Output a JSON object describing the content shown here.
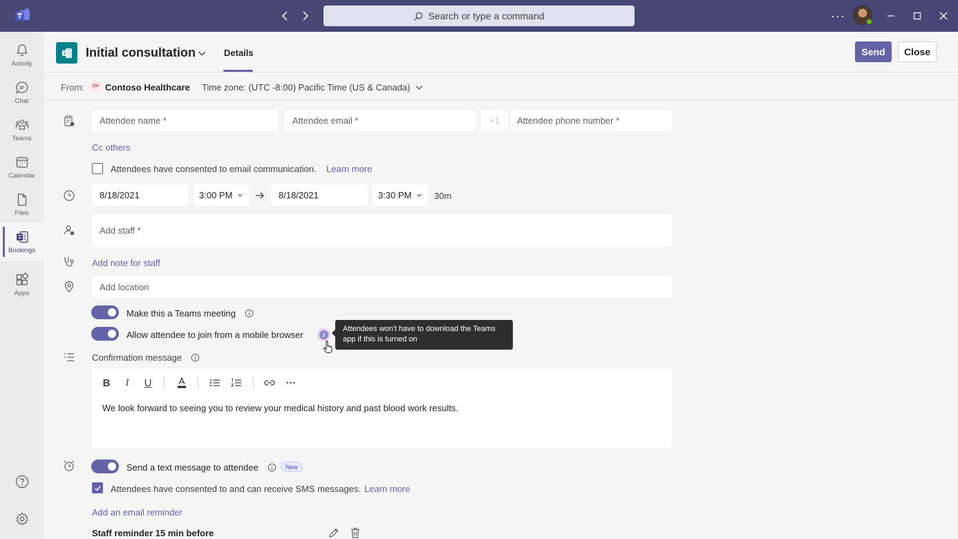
{
  "titlebar": {
    "search_placeholder": "Search or type a command",
    "more_label": "···"
  },
  "rail": {
    "items": [
      {
        "label": "Activity",
        "icon": "bell-icon"
      },
      {
        "label": "Chat",
        "icon": "chat-icon"
      },
      {
        "label": "Teams",
        "icon": "teams-icon"
      },
      {
        "label": "Calendar",
        "icon": "calendar-icon"
      },
      {
        "label": "Files",
        "icon": "file-icon"
      },
      {
        "label": "Bookings",
        "icon": "bookings-icon"
      },
      {
        "label": "Apps",
        "icon": "apps-icon"
      }
    ],
    "active": "Bookings"
  },
  "header": {
    "title": "Initial consultation",
    "tab_details": "Details",
    "send_label": "Send",
    "close_label": "Close"
  },
  "from_row": {
    "from_label": "From:",
    "business_initials": "CH",
    "business_name": "Contoso Healthcare",
    "timezone": "Time zone: (UTC -8:00) Pacific Time (US & Canada)"
  },
  "form": {
    "attendee_name_placeholder": "Attendee name *",
    "attendee_email_placeholder": "Attendee email *",
    "country_code": "+1",
    "attendee_phone_placeholder": "Attendee phone number *",
    "cc_others": "Cc others",
    "email_consent_text": "Attendees have consented to email communication.",
    "email_consent_checked": false,
    "learn_more": "Learn more",
    "start_date": "8/18/2021",
    "start_time": "3:00 PM",
    "end_date": "8/18/2021",
    "end_time": "3:30 PM",
    "duration": "30m",
    "add_staff_placeholder": "Add staff *",
    "add_note_for_staff": "Add note for staff",
    "add_location_placeholder": "Add location",
    "teams_meeting_label": "Make this a Teams meeting",
    "teams_meeting_on": true,
    "mobile_browser_label": "Allow attendee to join from a mobile browser",
    "mobile_browser_on": true,
    "tooltip_text": "Attendees won't have to download the Teams app if this is turned on",
    "confirmation_label": "Confirmation message",
    "confirmation_body": "We look forward to seeing you to review your medical history and past blood work results.",
    "text_message_label": "Send a text message to attendee",
    "text_message_on": true,
    "new_badge": "New",
    "sms_consent_text": "Attendees have consented to and can receive SMS messages.",
    "sms_consent_checked": true,
    "add_email_reminder": "Add an email reminder",
    "staff_reminder": "Staff reminder 15 min before"
  },
  "editor_toolbar": {
    "bold": "B",
    "italic": "I",
    "underline": "U",
    "more": "···"
  },
  "colors": {
    "titlebar": "#464775",
    "accent": "#6264a7",
    "app_icon": "#038387"
  }
}
